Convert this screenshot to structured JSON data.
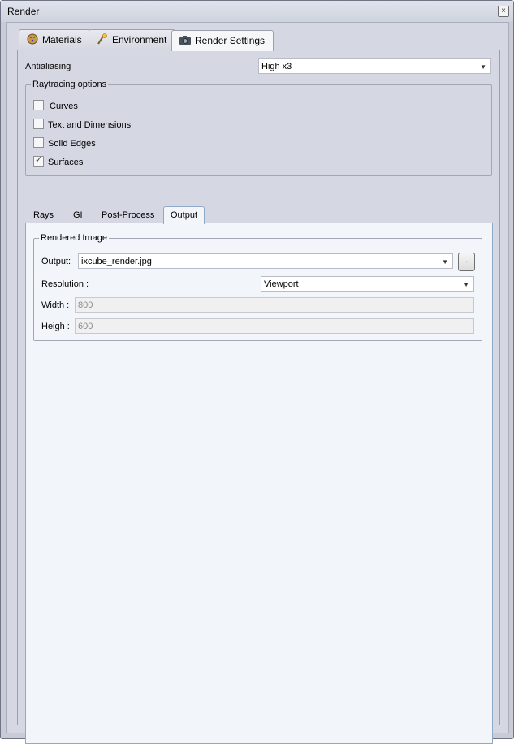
{
  "window": {
    "title": "Render",
    "close_glyph": "×"
  },
  "tabs": [
    {
      "label": "Materials",
      "icon": "materials-icon"
    },
    {
      "label": "Environment",
      "icon": "environment-icon"
    },
    {
      "label": "Render Settings",
      "icon": "camera-icon",
      "active": true
    }
  ],
  "antialiasing": {
    "label": "Antialiasing",
    "value": "High x3"
  },
  "raytracing": {
    "title": "Raytracing options",
    "options": [
      {
        "label": "Curves",
        "checked": false
      },
      {
        "label": "Text and Dimensions",
        "checked": false
      },
      {
        "label": "Solid Edges",
        "checked": false
      },
      {
        "label": "Surfaces",
        "checked": true
      }
    ]
  },
  "subtabs": [
    {
      "label": "Rays"
    },
    {
      "label": "GI"
    },
    {
      "label": "Post-Process"
    },
    {
      "label": "Output",
      "active": true
    }
  ],
  "rendered_image": {
    "title": "Rendered Image",
    "output_label": "Output:",
    "output_value": "ixcube_render.jpg",
    "browse_label": "...",
    "resolution_label": "Resolution :",
    "resolution_value": "Viewport",
    "width_label": "Width :",
    "width_value": "800",
    "height_label": "Heigh :",
    "height_value": "600"
  },
  "colors": {
    "accent_border": "#8fa9c9",
    "panel_bg": "#f2f6fb",
    "window_bg": "#d5d7e2"
  }
}
